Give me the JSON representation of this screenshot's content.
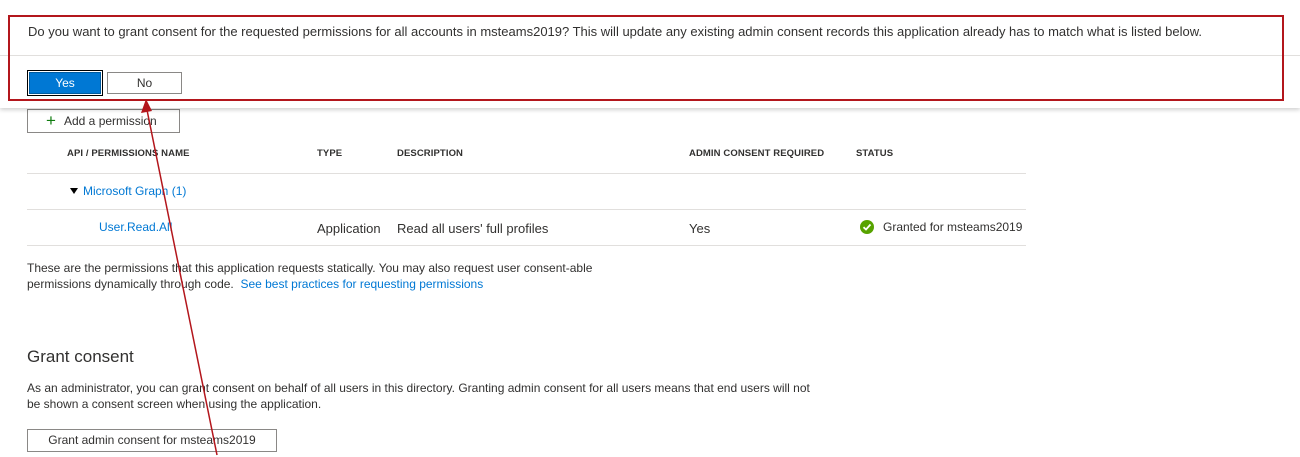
{
  "banner": {
    "message": "Do you want to grant consent for the requested permissions for all accounts in msteams2019? This will update any existing admin consent records this application already has to match what is listed below.",
    "yes_label": "Yes",
    "no_label": "No"
  },
  "permissions": {
    "add_label": "Add a permission",
    "columns": [
      "API / PERMISSIONS NAME",
      "TYPE",
      "DESCRIPTION",
      "ADMIN CONSENT REQUIRED",
      "STATUS"
    ],
    "group": "Microsoft Graph (1)",
    "rows": [
      {
        "name": "User.Read.All",
        "type": "Application",
        "description": "Read all users' full profiles",
        "admin_consent": "Yes",
        "status": "Granted for msteams2019"
      }
    ],
    "note": "These are the permissions that this application requests statically. You may also request user consent-able permissions dynamically through code.",
    "note_link": "See best practices for requesting permissions"
  },
  "grant": {
    "title": "Grant consent",
    "description": "As an administrator, you can grant consent on behalf of all users in this directory. Granting admin consent for all users means that end users will not be shown a consent screen when using the application.",
    "button_label": "Grant admin consent for msteams2019"
  },
  "colors": {
    "accent": "#0078d4",
    "annotation": "#b3161c",
    "success": "#57a300"
  }
}
